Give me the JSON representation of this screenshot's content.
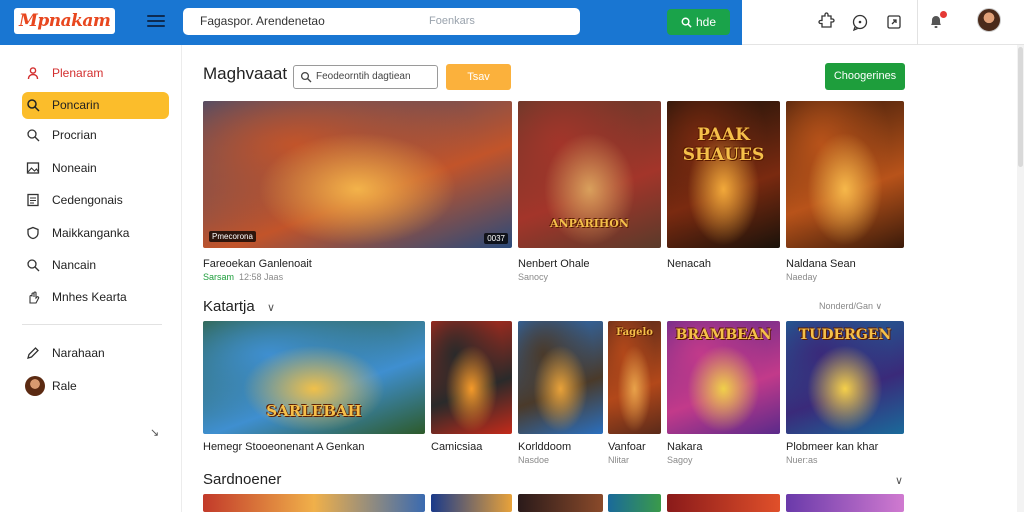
{
  "header": {
    "logo": "Mpnakam",
    "search_value": "Fagaspor. Arendenetao",
    "search_hint": "Foenkars",
    "search_button": "hde"
  },
  "sidebar": {
    "items": [
      {
        "label": "Plenaram",
        "icon": "person-icon"
      },
      {
        "label": "Poncarin",
        "icon": "search-icon"
      },
      {
        "label": "Procrian",
        "icon": "search-icon"
      },
      {
        "label": "Noneain",
        "icon": "image-icon"
      },
      {
        "label": "Cedengonais",
        "icon": "document-icon"
      },
      {
        "label": "Maikkanganka",
        "icon": "shield-icon"
      },
      {
        "label": "Nancain",
        "icon": "search-icon"
      },
      {
        "label": "Mnhes Kearta",
        "icon": "hand-icon"
      },
      {
        "label": "Narahaan",
        "icon": "pencil-icon"
      },
      {
        "label": "Rale",
        "icon": "avatar"
      }
    ],
    "collapse_glyph": "↘"
  },
  "main": {
    "title": "Maghvaaat",
    "filter_placeholder": "Feodeorntih dagtiean",
    "yellow_button": "Tsav",
    "green_button": "Choogerines",
    "row1": [
      {
        "title": "Fareoekan Ganlenoait",
        "sub_green": "Sarsam",
        "sub": "12:58 Jaas",
        "badge_left": "Pmecorona",
        "badge_right": "0037",
        "colors": [
          "#2a4a7a",
          "#c2542a",
          "#f3b34a"
        ],
        "overtitle": ""
      },
      {
        "title": "Nenbert Ohale",
        "sub": "Sanocy",
        "overtitle": "ANPARIHON",
        "colors": [
          "#5a3a2a",
          "#a3352a",
          "#d9a05c"
        ]
      },
      {
        "title": "Nenacah",
        "sub": "",
        "overtitle": "PAAK SHAUES",
        "colors": [
          "#1a120a",
          "#7a2a10",
          "#f2a93a"
        ]
      },
      {
        "title": "Naldana Sean",
        "sub": "Naeday",
        "overtitle": "",
        "colors": [
          "#3a1a0a",
          "#b8531a",
          "#f6b84a"
        ]
      }
    ],
    "section2": {
      "title": "Katartja",
      "chev": "∨",
      "link": "Nonderd/Gan ∨"
    },
    "row2": [
      {
        "title": "Hemegr Stooeonenant A Genkan",
        "sub": "",
        "overtitle": "SARLEBAH",
        "colors": [
          "#2d5a2a",
          "#3f8fd0",
          "#f0c04a"
        ]
      },
      {
        "title": "Camicsiaa",
        "sub": "",
        "overtitle": "",
        "colors": [
          "#c42a1a",
          "#2a2a2a",
          "#f59a2a"
        ]
      },
      {
        "title": "Korlddoom",
        "sub": "Nasdoe",
        "overtitle": "",
        "colors": [
          "#2a6fbf",
          "#4a3a2a",
          "#e8a23a"
        ]
      },
      {
        "title": "Vanfoar",
        "sub": "Nlitar",
        "overtitle": "Fagelo",
        "colors": [
          "#5a2a1a",
          "#b2481a",
          "#e8a24a"
        ]
      },
      {
        "title": "Nakara",
        "sub": "Sagoy",
        "overtitle": "BRAMBEAN",
        "colors": [
          "#5a2a8a",
          "#c23a8a",
          "#f0d04a"
        ]
      },
      {
        "title": "Plobmeer kan khar",
        "sub": "Nuer:as",
        "overtitle": "TUDERGEN",
        "colors": [
          "#1a6a9a",
          "#3a2a7a",
          "#f5d04a"
        ]
      }
    ],
    "section3": {
      "title": "Sardnoener",
      "chev": "∨"
    }
  }
}
